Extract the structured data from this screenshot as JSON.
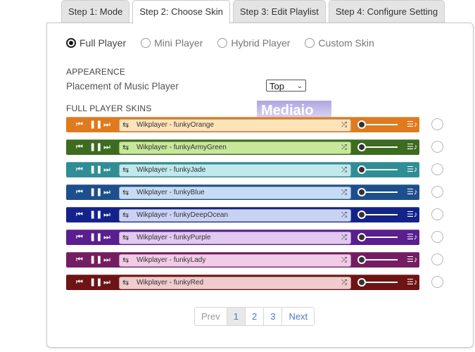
{
  "tabs": [
    "Step 1: Mode",
    "Step 2: Choose Skin",
    "Step 3: Edit Playlist",
    "Step 4: Configure Setting"
  ],
  "active_tab": 1,
  "modes": [
    {
      "label": "Full Player",
      "checked": true
    },
    {
      "label": "Mini Player",
      "checked": false
    },
    {
      "label": "Hybrid Player",
      "checked": false
    },
    {
      "label": "Custom Skin",
      "checked": false
    }
  ],
  "appearance": {
    "heading": "APPEARENCE",
    "placement_label": "Placement of Music Player",
    "placement_value": "Top"
  },
  "skins_heading": "FULL PLAYER SKINS",
  "watermark": "Mediaio",
  "skins": [
    {
      "title": "Wikplayer - funkyOrange",
      "bar_color": "#e07a1f",
      "track_color": "#fde3b8"
    },
    {
      "title": "Wikplayer - funkyArmyGreen",
      "bar_color": "#3d6b1f",
      "track_color": "#c7e89a"
    },
    {
      "title": "Wikplayer - funkyJade",
      "bar_color": "#2f8e95",
      "track_color": "#bfe9ec"
    },
    {
      "title": "Wikplayer - funkyBlue",
      "bar_color": "#1d4f8c",
      "track_color": "#c6dcf6"
    },
    {
      "title": "Wikplayer - funkyDeepOcean",
      "bar_color": "#14238a",
      "track_color": "#c9d2f3"
    },
    {
      "title": "Wikplayer - funkyPurple",
      "bar_color": "#5a1e8e",
      "track_color": "#e1c9f2"
    },
    {
      "title": "Wikplayer - funkyLady",
      "bar_color": "#751d63",
      "track_color": "#f2cbe6"
    },
    {
      "title": "Wikplayer - funkyRed",
      "bar_color": "#6e1414",
      "track_color": "#f0cccc"
    }
  ],
  "controls": {
    "prev_icon": "skip-back",
    "pause_icon": "pause",
    "next_icon": "skip-forward",
    "repeat_icon": "repeat",
    "shuffle_icon": "shuffle",
    "playlist_icon": "playlist"
  },
  "pagination": {
    "prev": "Prev",
    "pages": [
      "1",
      "2",
      "3"
    ],
    "current": "1",
    "next": "Next"
  }
}
